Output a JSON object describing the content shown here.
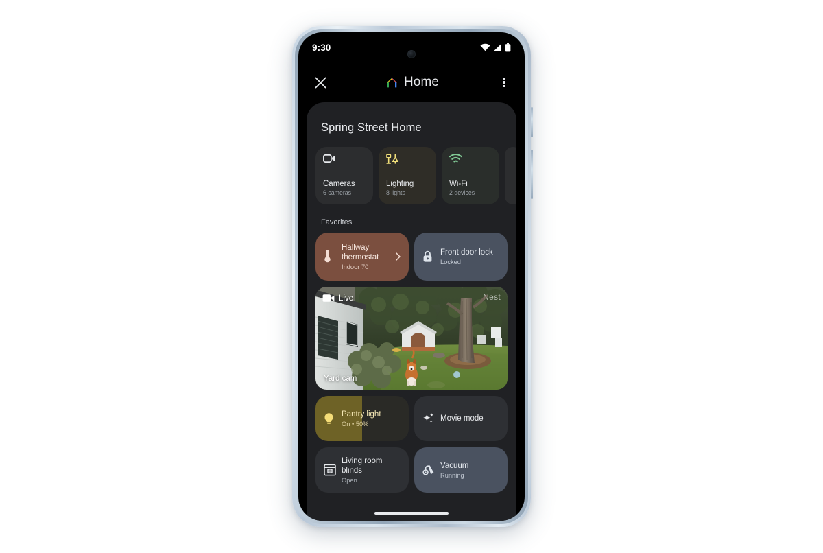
{
  "device": {
    "frame_color": "#c6d4e2",
    "screen_bg": "#000000"
  },
  "statusbar": {
    "time": "9:30",
    "icons": [
      "wifi-icon",
      "cell-signal-icon",
      "battery-icon"
    ]
  },
  "appbar": {
    "close_label": "×",
    "close_icon": "close-icon",
    "logo_icon": "google-home-logo",
    "title": "Home",
    "overflow_icon": "more-vert-icon"
  },
  "sheet": {
    "home_name": "Spring Street Home"
  },
  "chips": [
    {
      "icon": "camera-icon",
      "label": "Cameras",
      "sub": "6 cameras",
      "tint": "",
      "icon_color": "#e8eaed"
    },
    {
      "icon": "lighting-icon",
      "label": "Lighting",
      "sub": "8 lights",
      "tint": "tint-light",
      "icon_color": "#f2e07a"
    },
    {
      "icon": "wifi-icon",
      "label": "Wi-Fi",
      "sub": "2 devices",
      "tint": "tint-wifi",
      "icon_color": "#81c995"
    }
  ],
  "favorites": {
    "section_title": "Favorites",
    "thermostat": {
      "icon": "thermostat-icon",
      "title": "Hallway thermostat",
      "sub": "Indoor 70",
      "chevron": "chevron-right-icon",
      "bg": "#7b4f3f"
    },
    "lock": {
      "icon": "lock-icon",
      "title": "Front door lock",
      "sub": "Locked",
      "bg": "#4a5260"
    }
  },
  "camera": {
    "live_icon": "video-camera-icon",
    "live_label": "Live",
    "name": "Yard cam",
    "watermark": "Nest",
    "scene": "backyard with house, doghouse, dog on lawn, large tree and hedges"
  },
  "controls": [
    {
      "id": "pantry",
      "icon": "lightbulb-icon",
      "title": "Pantry light",
      "sub": "On • 50%",
      "brightness_percent": 50,
      "fill_color": "#6e6226",
      "bg": "#2a2a26"
    },
    {
      "id": "movie",
      "icon": "sparkle-icon",
      "title": "Movie mode",
      "sub": "",
      "bg": "#2e3034"
    },
    {
      "id": "blinds",
      "icon": "blinds-icon",
      "title": "Living room blinds",
      "sub": "Open",
      "bg": "#2e3034"
    },
    {
      "id": "vacuum",
      "icon": "vacuum-icon",
      "title": "Vacuum",
      "sub": "Running",
      "bg": "#4a5260"
    }
  ],
  "nav": {
    "home_indicator": "home-indicator"
  }
}
